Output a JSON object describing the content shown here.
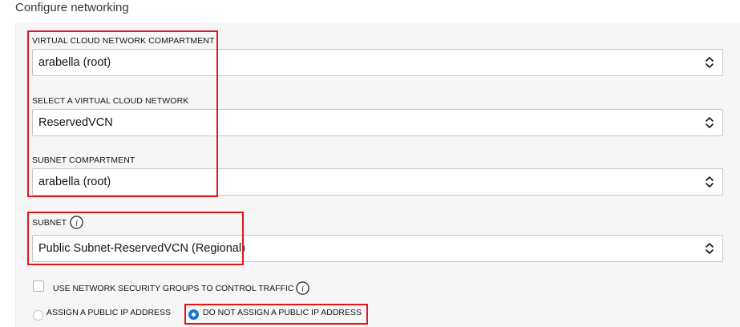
{
  "section": {
    "title": "Configure networking"
  },
  "vcn_compartment": {
    "label": "VIRTUAL CLOUD NETWORK COMPARTMENT",
    "value": "arabella (root)"
  },
  "vcn": {
    "label": "SELECT A VIRTUAL CLOUD NETWORK",
    "value": "ReservedVCN"
  },
  "subnet_compartment": {
    "label": "SUBNET COMPARTMENT",
    "value": "arabella (root)"
  },
  "subnet": {
    "label": "SUBNET",
    "value": "Public Subnet-ReservedVCN (Regional)"
  },
  "nsg": {
    "label": "USE NETWORK SECURITY GROUPS TO CONTROL TRAFFIC",
    "checked": false
  },
  "public_ip": {
    "options": [
      {
        "label": "ASSIGN A PUBLIC IP ADDRESS",
        "selected": false
      },
      {
        "label": "DO NOT ASSIGN A PUBLIC IP ADDRESS",
        "selected": true
      }
    ]
  },
  "colors": {
    "highlight": "#e0161d",
    "radio_selected": "#1b74d3",
    "panel_bg": "#f6f6f6"
  },
  "icons": {
    "select_arrows": "chevron-up-down-icon",
    "info": "info-icon"
  }
}
